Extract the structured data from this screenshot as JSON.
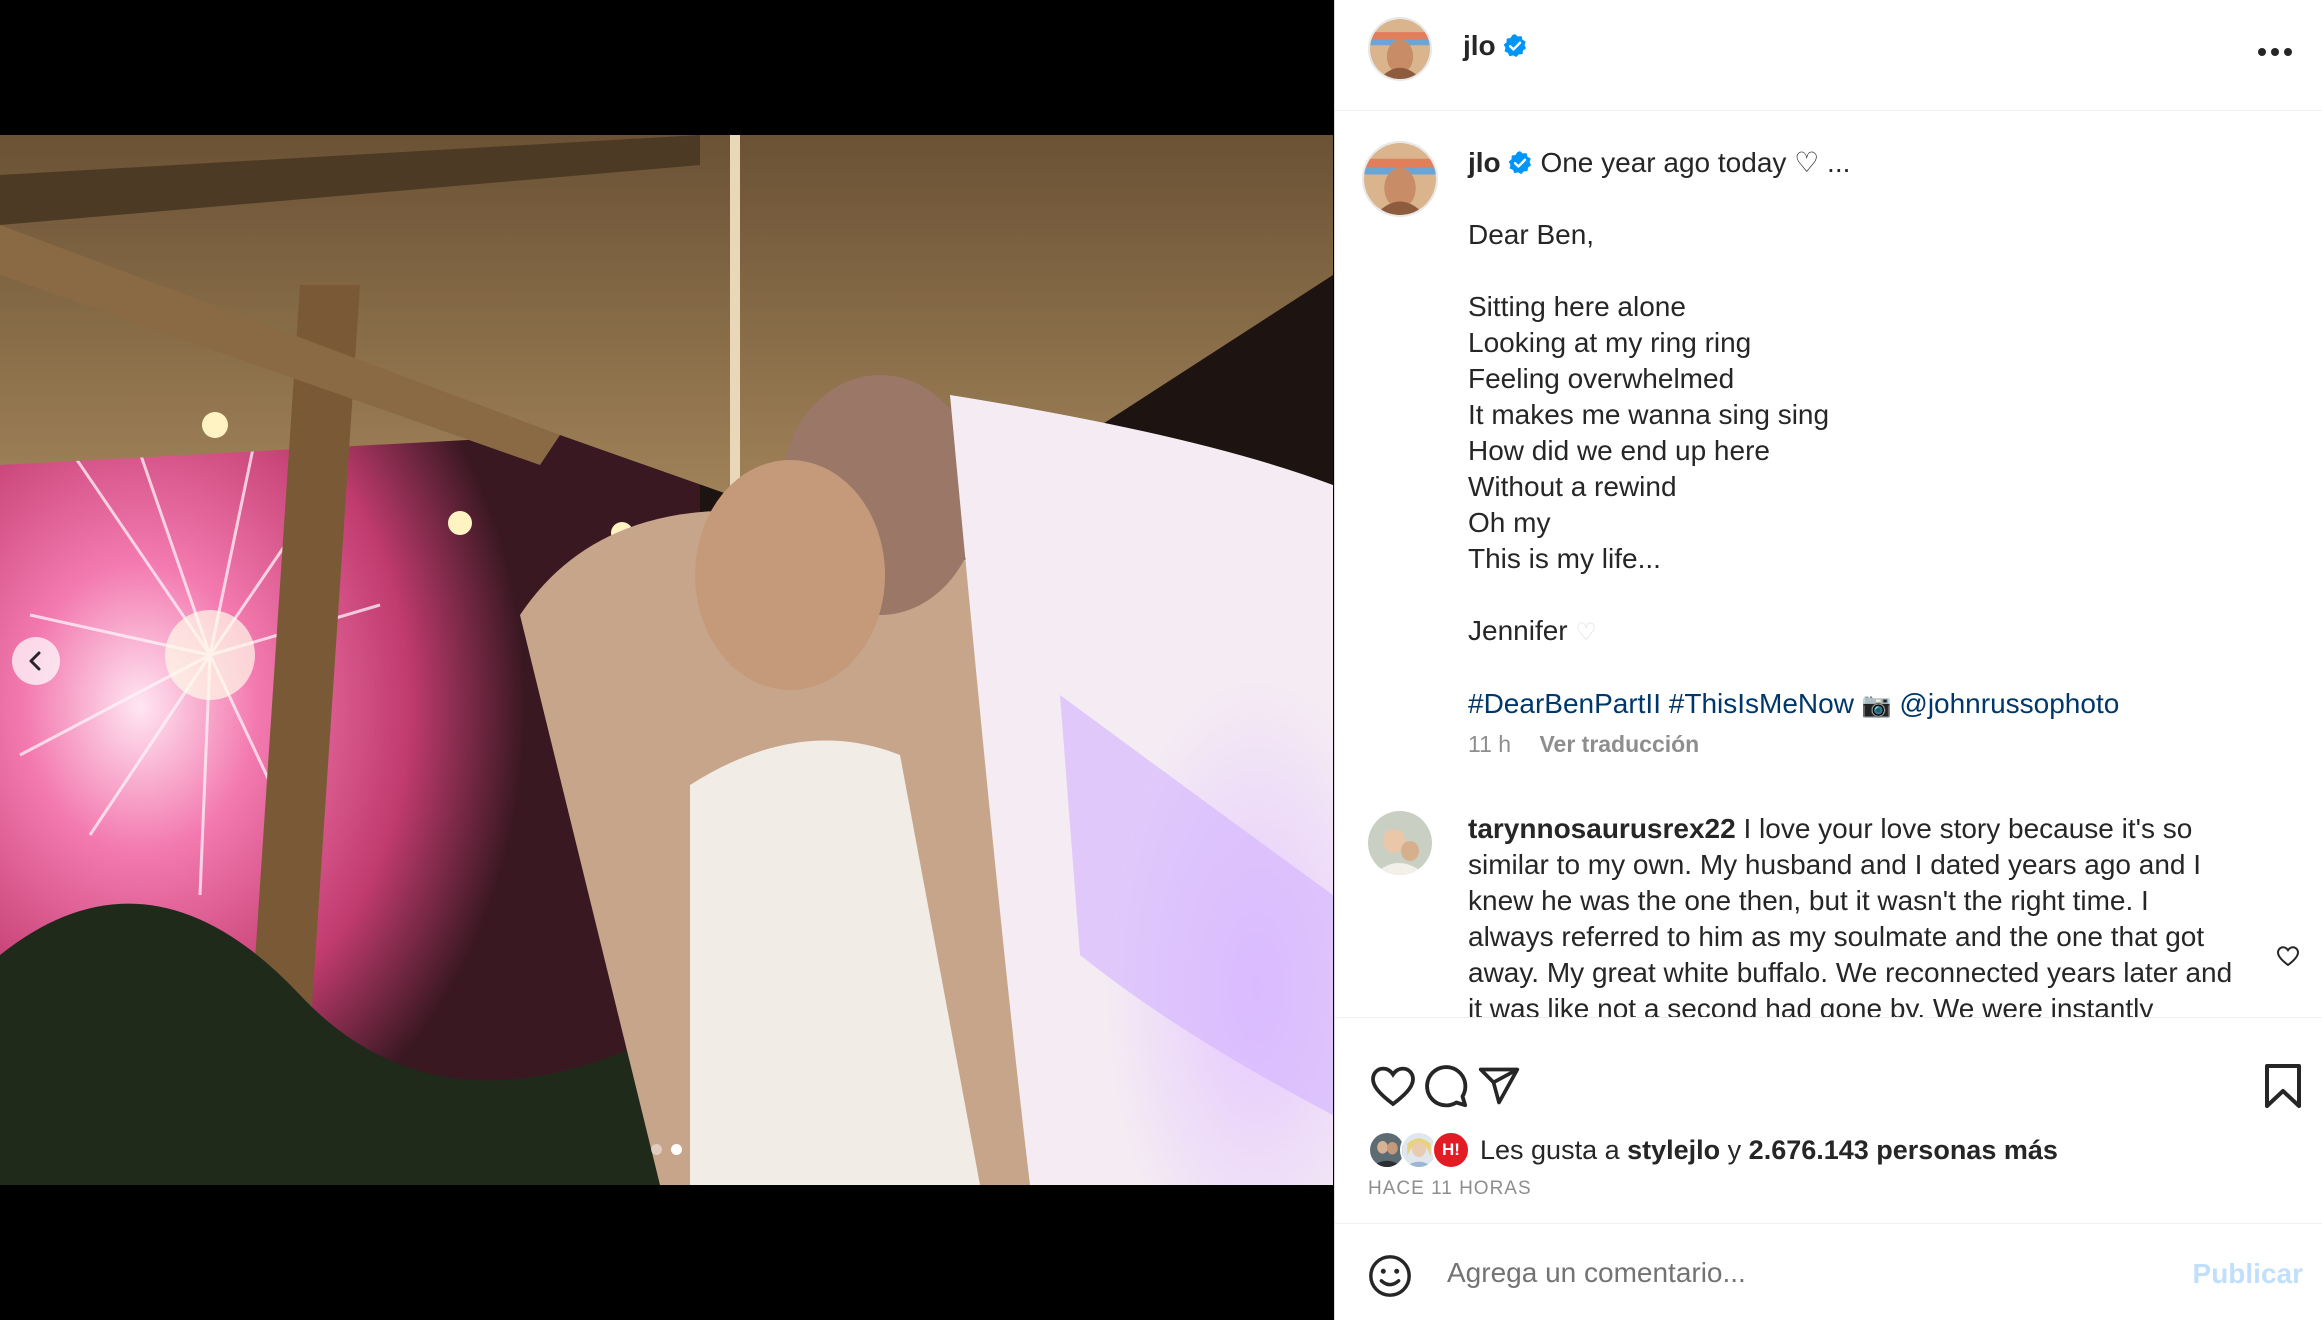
{
  "post": {
    "username": "jlo",
    "verified": true,
    "more_icon": "more-horizontal-icon"
  },
  "caption": {
    "username": "jlo",
    "first_line": " One year ago today ♡ ...",
    "lines": [
      "Dear Ben,",
      "",
      "Sitting here alone",
      "Looking at my ring ring",
      "Feeling overwhelmed",
      "It makes me wanna sing sing",
      "How did we end up here",
      "Without a rewind",
      "Oh my",
      "This is my life...",
      "",
      "Jennifer"
    ],
    "hashtags": "#DearBenPartII #ThisIsMeNow",
    "photo_credit": "@johnrussophoto",
    "time": "11 h",
    "translate_label": "Ver traducción"
  },
  "comment": {
    "username": "tarynnosaurusrex22",
    "text": " I love your love story because it's so similar to my own. My husband and I dated years ago and I knew he was the one then, but it wasn't the right time. I always referred to him as my soulmate and the one that got away. My great white buffalo. We reconnected years later and it was like not a second had gone by. We were instantly"
  },
  "likes": {
    "prefix": "Les gusta a ",
    "liker": "stylejlo",
    "connector": " y ",
    "others": "2.676.143 personas más",
    "badge": "H!",
    "time_ago": "HACE 11 HORAS"
  },
  "composer": {
    "placeholder": "Agrega un comentario...",
    "post_label": "Publicar"
  },
  "carousel": {
    "count": 2,
    "active_index": 1
  },
  "colors": {
    "link": "#00376b",
    "verified": "#0095f6",
    "post_button_disabled": "#c0dffd"
  }
}
